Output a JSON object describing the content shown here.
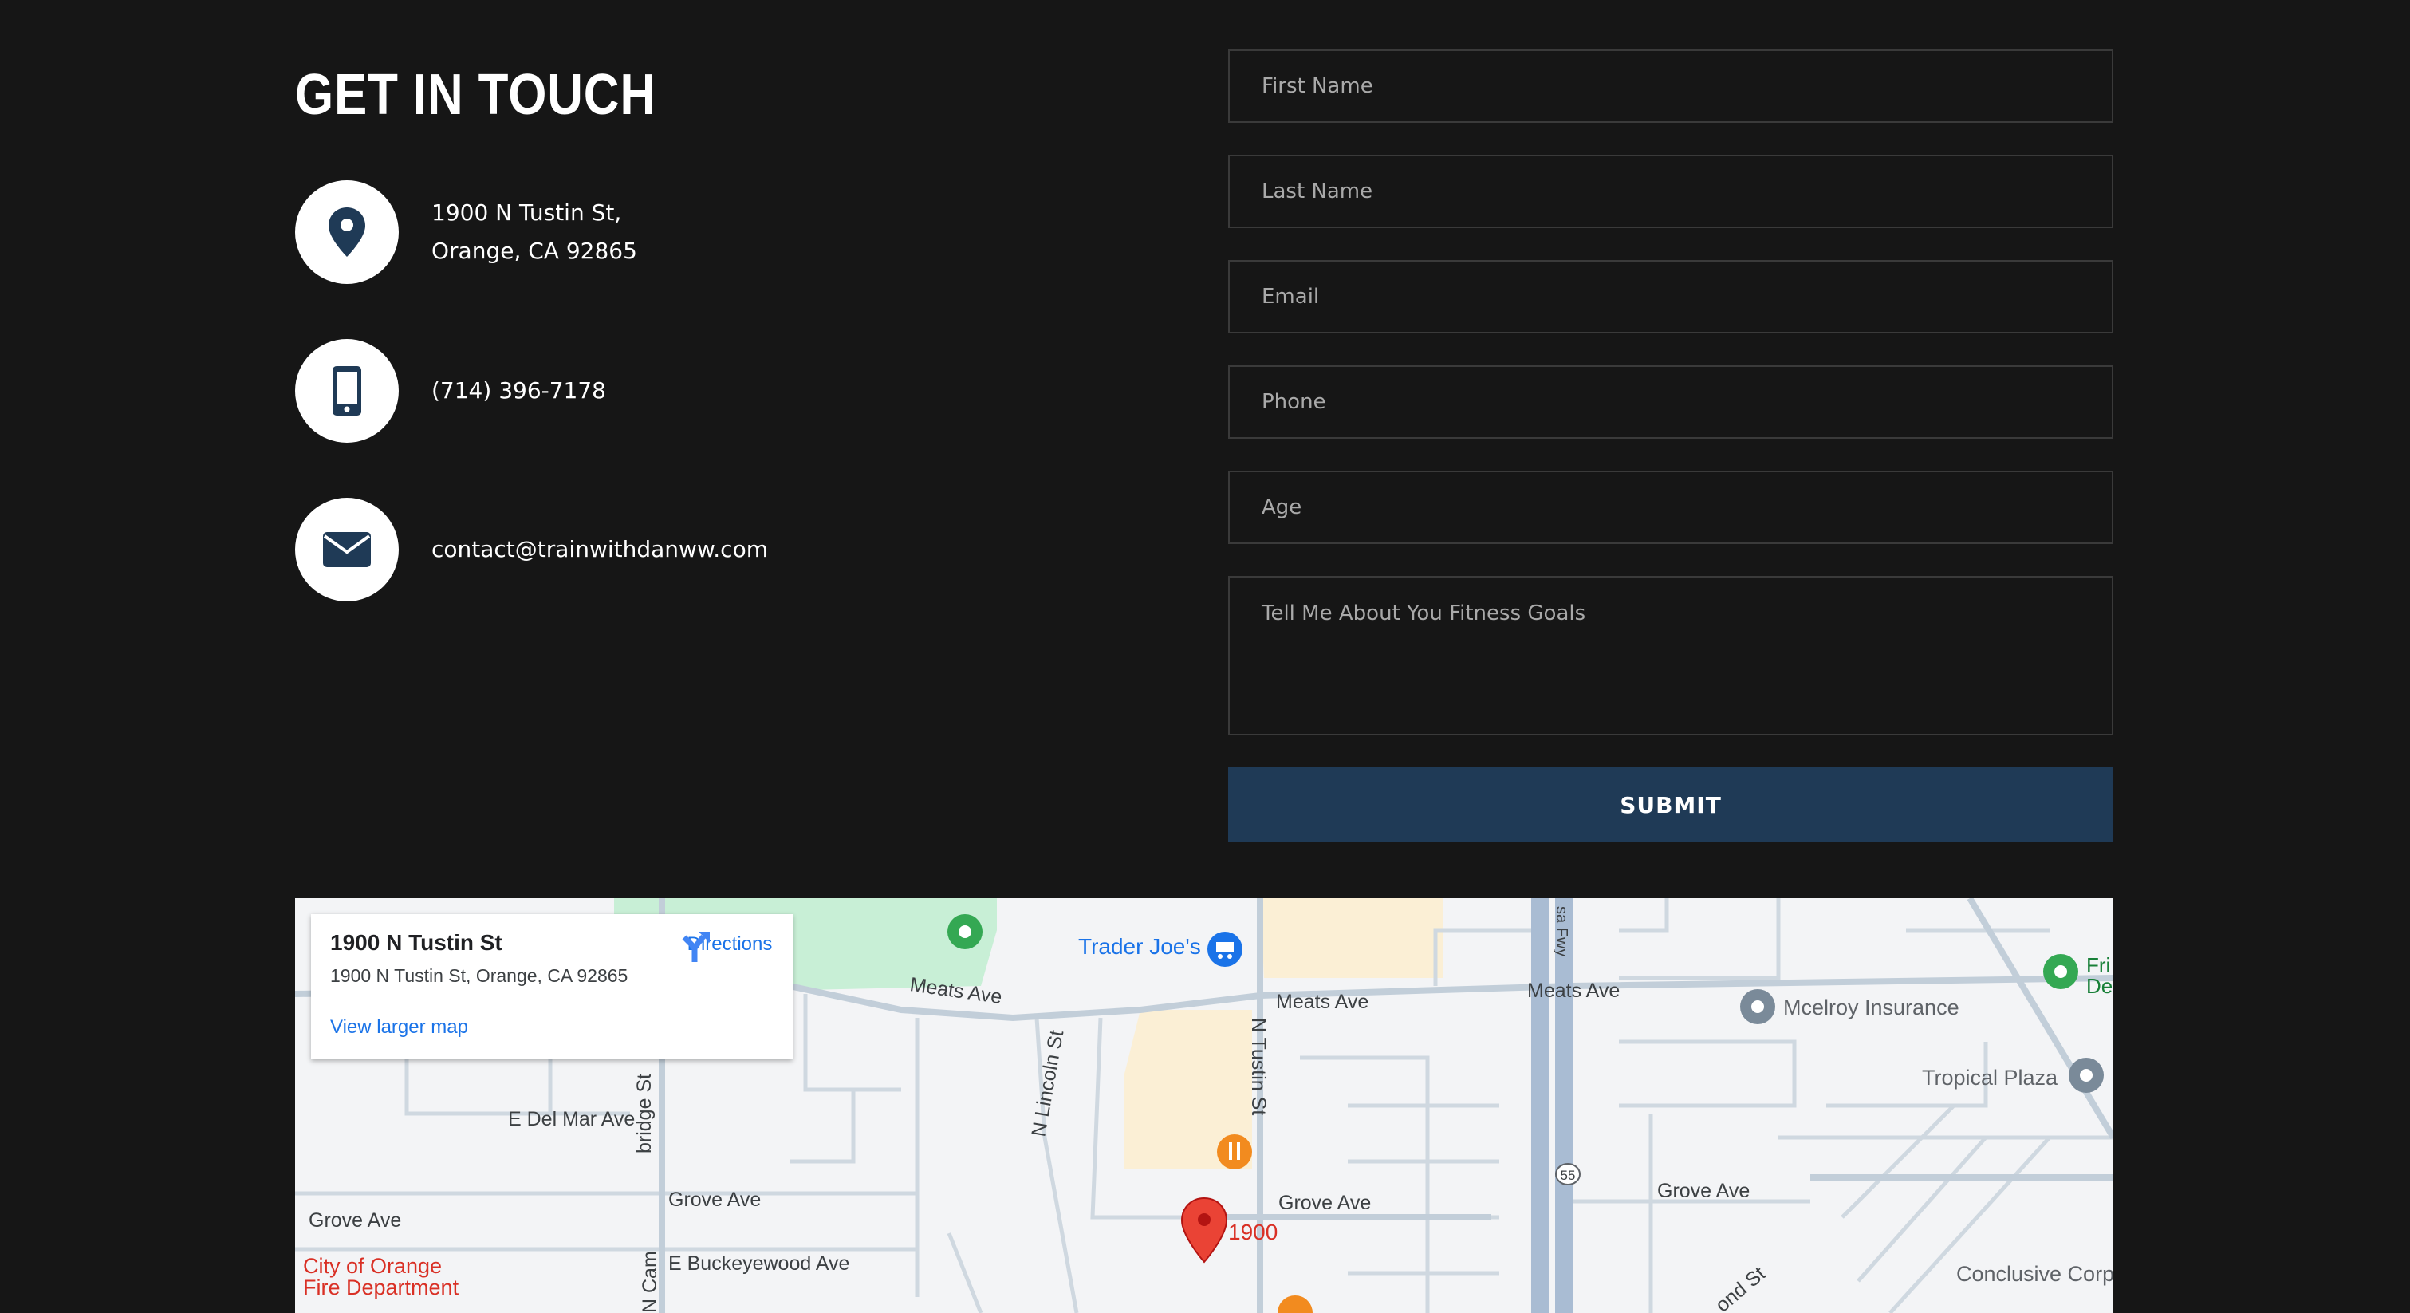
{
  "contact": {
    "title": "GET IN TOUCH",
    "address_line1": "1900 N Tustin St,",
    "address_line2": "Orange, CA 92865",
    "phone": "(714) 396-7178",
    "email": "contact@trainwithdanww.com",
    "icons": [
      "location-pin-icon",
      "mobile-phone-icon",
      "envelope-icon"
    ]
  },
  "form": {
    "first_name_placeholder": "First Name",
    "last_name_placeholder": "Last Name",
    "email_placeholder": "Email",
    "phone_placeholder": "Phone",
    "age_placeholder": "Age",
    "goals_placeholder": "Tell Me About You Fitness Goals",
    "submit_label": "SUBMIT"
  },
  "map": {
    "info_title": "1900 N Tustin St",
    "info_address": "1900 N Tustin St, Orange, CA 92865",
    "directions_label": "Directions",
    "view_larger_label": "View larger map",
    "marker_label": "1900",
    "labels": {
      "meats_ave_1": "Meats Ave",
      "meats_ave_2": "Meats Ave",
      "meats_ave_3": "Meats Ave",
      "trader_joes": "Trader Joe's",
      "mcelroy": "Mcelroy Insurance",
      "tropical": "Tropical Plaza",
      "e_del_mar": "E Del Mar Ave",
      "n_lincoln": "N Lincoln St",
      "n_tustin": "N Tustin St",
      "grove_1": "Grove Ave",
      "grove_2": "Grove Ave",
      "grove_3": "Grove Ave",
      "grove_4": "Grove Ave",
      "buckeyewood": "E Buckeyewood Ave",
      "fire_1": "City of Orange",
      "fire_2": "Fire Department",
      "conclusive": "Conclusive Corp",
      "fri_1": "Fri",
      "fri_2": "De",
      "bridge": "bridge St",
      "n_cam": "N Cam",
      "ond_st": "ond St",
      "fwy": "sa Fwy",
      "hwy_55": "55"
    }
  },
  "colors": {
    "background": "#161616",
    "submit_bg": "#1f3a56",
    "icon_color": "#1f3a56",
    "field_border": "#3a3a3a",
    "map_link": "#1a73e8",
    "marker_red": "#ea4335"
  }
}
